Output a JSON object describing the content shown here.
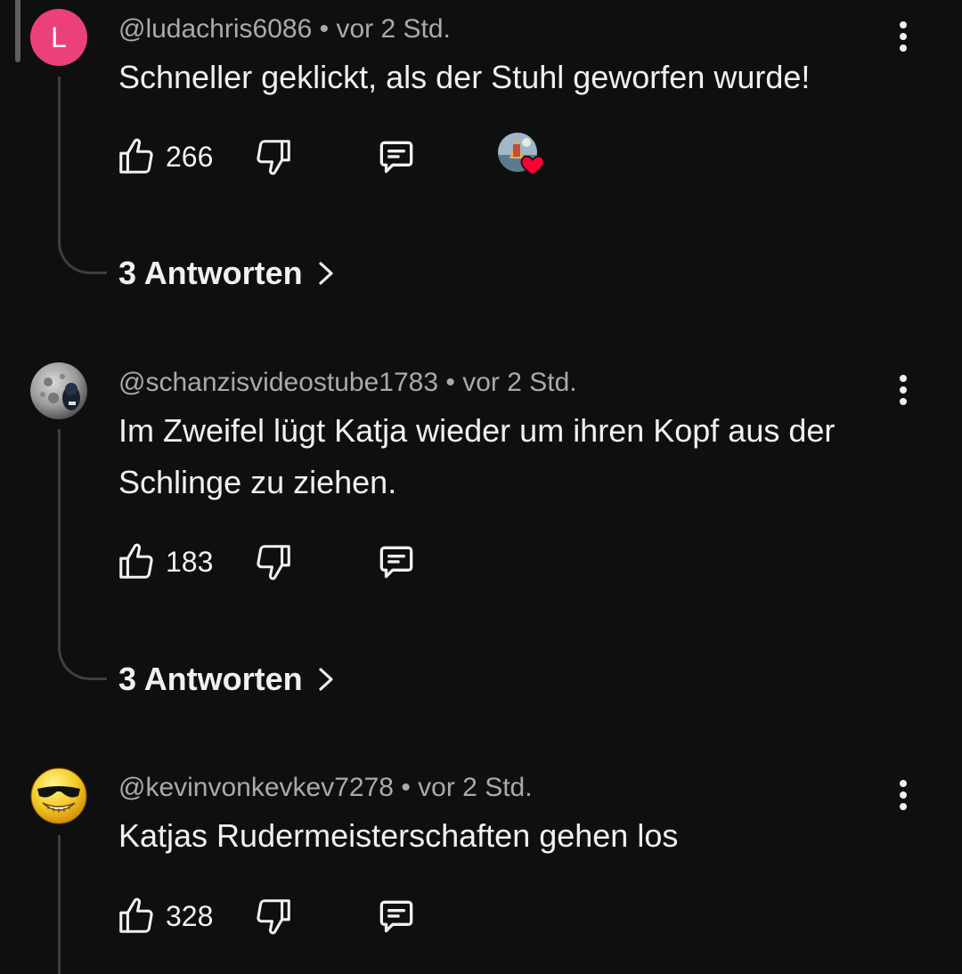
{
  "comments": [
    {
      "avatar_letter": "L",
      "avatar_color": "#ec407a",
      "handle": "@ludachris6086",
      "separator": "•",
      "time": "vor 2 Std.",
      "text": "Schneller geklickt, als der Stuhl geworfen wurde!",
      "likes": "266",
      "creator_hearted": true,
      "replies_label": "3 Antworten"
    },
    {
      "avatar_letter": "",
      "handle": "@schanzisvideostube1783",
      "separator": "•",
      "time": "vor 2 Std.",
      "text": "Im Zweifel lügt Katja wieder um ihren Kopf aus der Schlinge zu ziehen.",
      "likes": "183",
      "creator_hearted": false,
      "replies_label": "3 Antworten"
    },
    {
      "avatar_letter": "",
      "handle": "@kevinvonkevkev7278",
      "separator": "•",
      "time": "vor 2 Std.",
      "text": "Katjas Rudermeisterschaften gehen los",
      "likes": "328",
      "creator_hearted": false
    }
  ],
  "icons": {
    "like": "thumbs-up-icon",
    "dislike": "thumbs-down-icon",
    "reply": "reply-comment-icon",
    "more": "more-vertical-icon",
    "expand": "chevron-right-icon",
    "heart": "heart-icon"
  },
  "colors": {
    "background": "#0f0f0f",
    "text": "#f1f1f1",
    "meta": "#aaaaaa",
    "heart": "#ff0033"
  }
}
